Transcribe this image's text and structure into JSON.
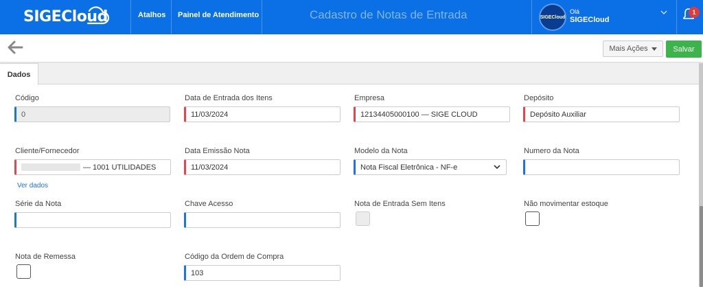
{
  "header": {
    "logo_text": "SIGE",
    "logo_text_2": "Cloud",
    "nav": [
      "Atalhos",
      "Painel de Atendimento"
    ],
    "title": "Cadastro de Notas de Entrada",
    "avatar_text": "SIGECloud",
    "greeting": "Olá",
    "user_name": "SIGECloud",
    "notification_count": "1"
  },
  "toolbar": {
    "more_actions_label": "Mais Ações",
    "save_label": "Salvar"
  },
  "tabs": [
    {
      "label": "Dados"
    }
  ],
  "form": {
    "codigo": {
      "label": "Código",
      "value": "0"
    },
    "data_entrada": {
      "label": "Data de Entrada dos Itens",
      "value": "11/03/2024"
    },
    "empresa": {
      "label": "Empresa",
      "value": "12134405000100 — SIGE CLOUD"
    },
    "deposito": {
      "label": "Depósito",
      "value": "Depósito Auxiliar"
    },
    "cliente": {
      "label": "Cliente/Fornecedor",
      "value": "— 1001 UTILIDADES",
      "link": "Ver dados"
    },
    "data_emissao": {
      "label": "Data Emissão Nota",
      "value": "11/03/2024"
    },
    "modelo": {
      "label": "Modelo da Nota",
      "value": "Nota Fiscal Eletrônica - NF-e"
    },
    "numero": {
      "label": "Numero da Nota",
      "value": ""
    },
    "serie": {
      "label": "Série da Nota",
      "value": ""
    },
    "chave": {
      "label": "Chave Acesso",
      "value": ""
    },
    "sem_itens": {
      "label": "Nota de Entrada Sem Itens"
    },
    "nao_mov": {
      "label": "Não movimentar estoque"
    },
    "remessa": {
      "label": "Nota de Remessa"
    },
    "ordem_compra": {
      "label": "Código da Ordem de Compra",
      "value": "103"
    }
  },
  "colors": {
    "brand": "#0b6fe6",
    "required": "#e5454b",
    "save": "#3cb34b"
  }
}
